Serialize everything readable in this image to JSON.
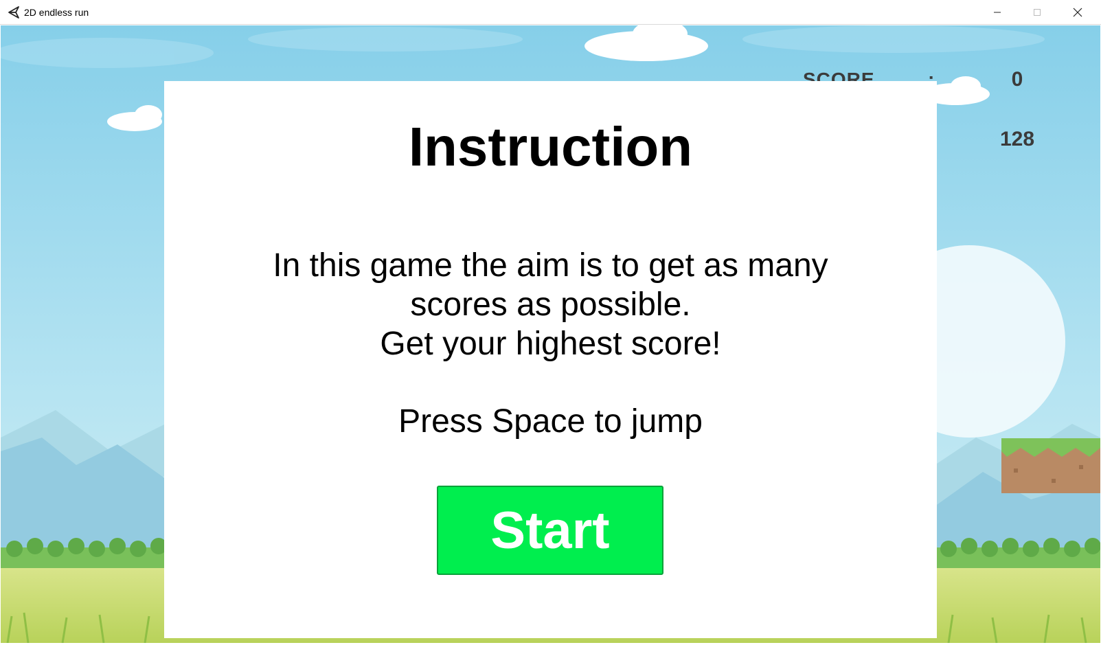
{
  "window": {
    "title": "2D endless run",
    "icon": "unity-icon",
    "controls": [
      "minimize-icon",
      "maximize-icon",
      "close-icon"
    ]
  },
  "hud": {
    "score_label": "SCORE",
    "score_colon": ":",
    "score_value": "0",
    "high_score_value": "128"
  },
  "instruction": {
    "title": "Instruction",
    "line1": "In this game the aim is to get as many",
    "line2": "scores as possible.",
    "line3": "Get your highest score!",
    "controls_hint": "Press Space to jump",
    "start_label": "Start"
  },
  "colors": {
    "start_button": "#00ee4e",
    "sky": "#8fd6ef",
    "grass": "#c8dc6e",
    "dirt_block": "#b98a64"
  }
}
